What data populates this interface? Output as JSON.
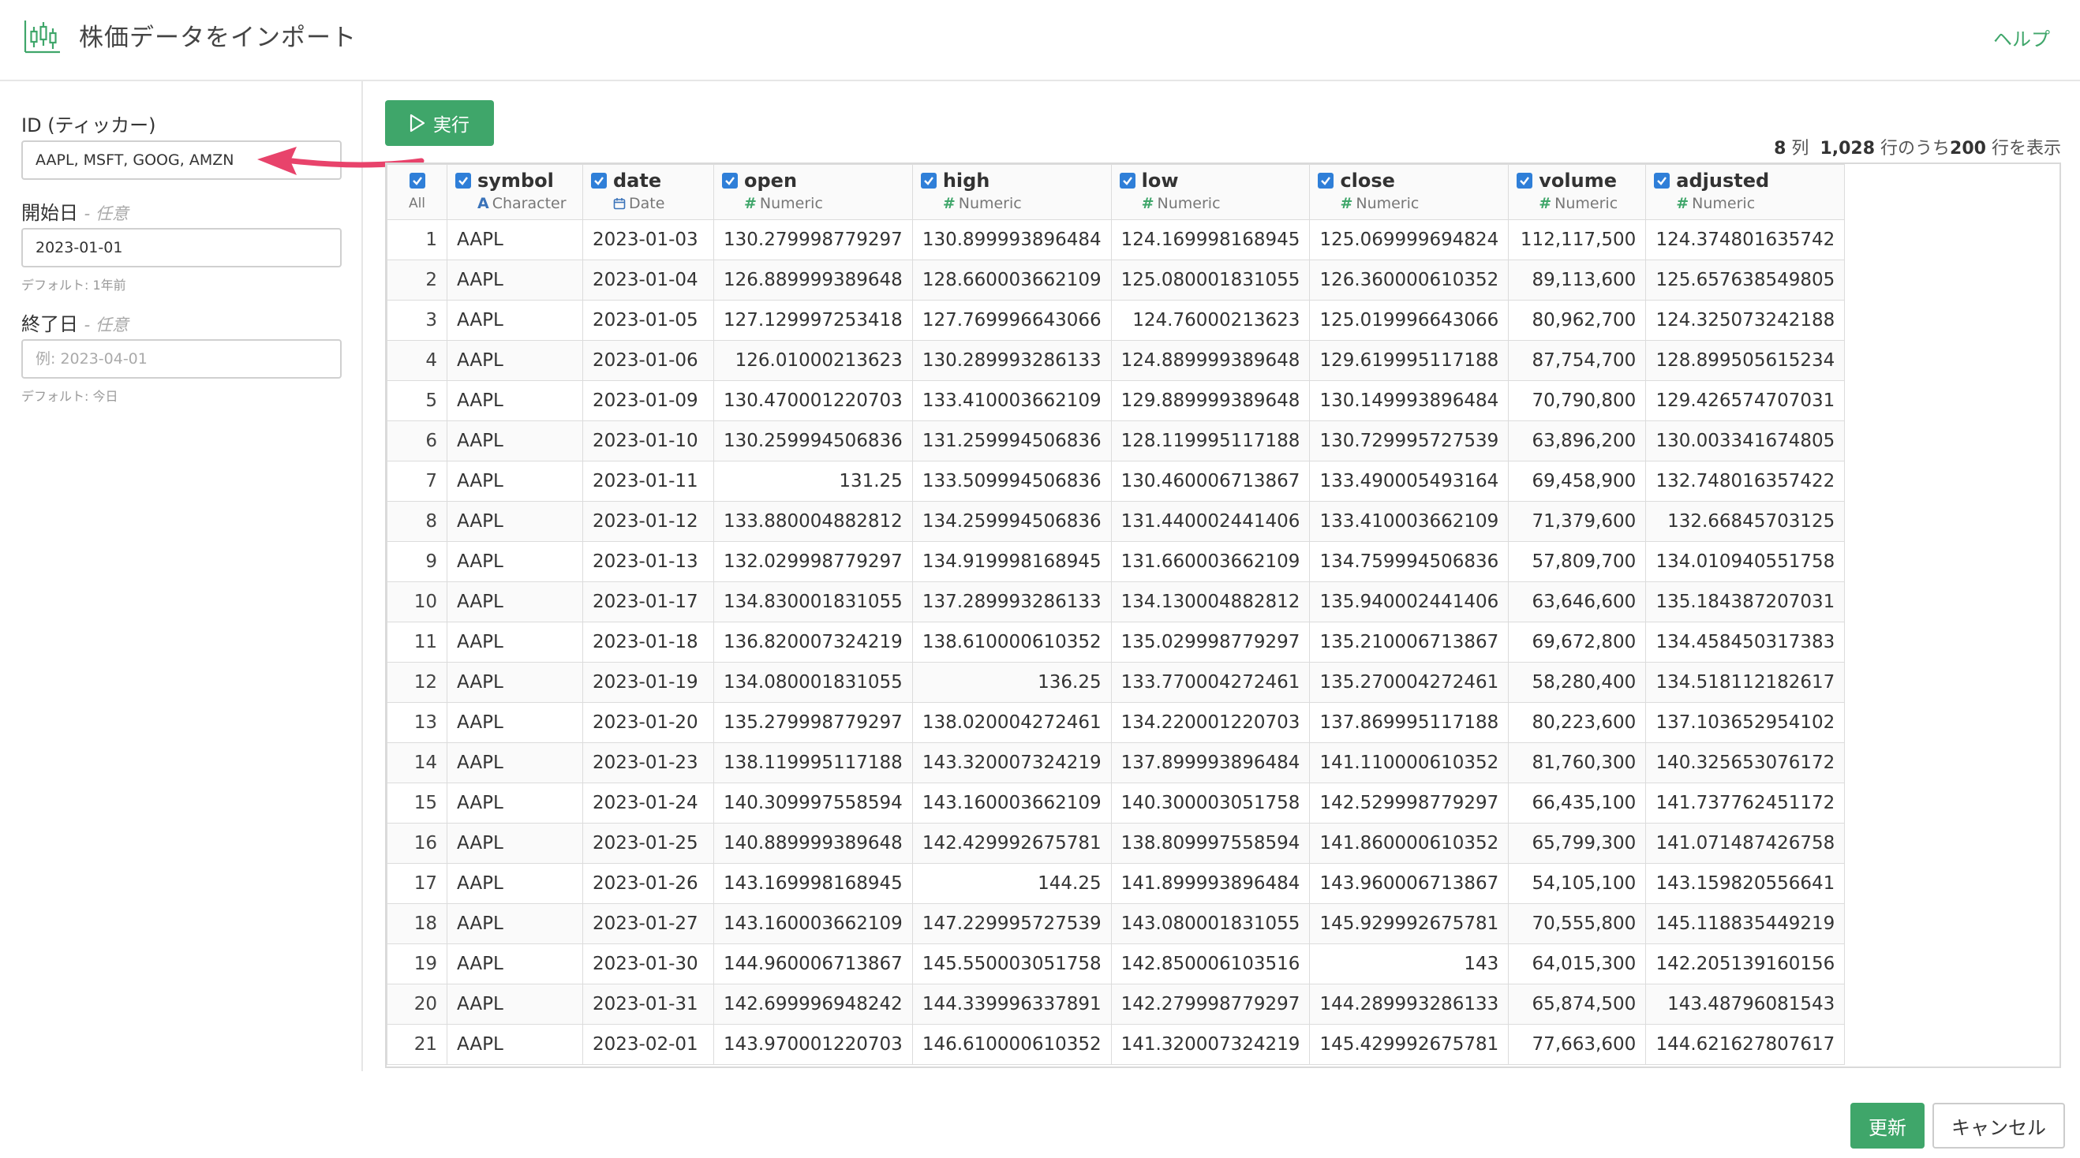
{
  "header": {
    "title": "株価データをインポート",
    "help_label": "ヘルプ"
  },
  "sidebar": {
    "id_label": "ID (ティッカー)",
    "id_value": "AAPL, MSFT, GOOG, AMZN",
    "start_label": "開始日",
    "start_optional": "- 任意",
    "start_value": "2023-01-01",
    "start_hint": "デフォルト: 1年前",
    "end_label": "終了日",
    "end_optional": "- 任意",
    "end_placeholder": "例: 2023-04-01",
    "end_hint": "デフォルト: 今日"
  },
  "toolbar": {
    "run_label": "実行"
  },
  "summary": {
    "cols": "8",
    "cols_unit": "列",
    "total_rows": "1,028",
    "middle_text": "行のうち",
    "shown_rows": "200",
    "tail_text": "行を表示"
  },
  "table": {
    "all_label": "All",
    "columns": [
      {
        "name": "symbol",
        "type": "Character",
        "type_icon": "A",
        "kind": "char"
      },
      {
        "name": "date",
        "type": "Date",
        "type_icon": "calendar-icon",
        "kind": "date"
      },
      {
        "name": "open",
        "type": "Numeric",
        "type_icon": "#",
        "kind": "num"
      },
      {
        "name": "high",
        "type": "Numeric",
        "type_icon": "#",
        "kind": "num"
      },
      {
        "name": "low",
        "type": "Numeric",
        "type_icon": "#",
        "kind": "num"
      },
      {
        "name": "close",
        "type": "Numeric",
        "type_icon": "#",
        "kind": "num"
      },
      {
        "name": "volume",
        "type": "Numeric",
        "type_icon": "#",
        "kind": "num"
      },
      {
        "name": "adjusted",
        "type": "Numeric",
        "type_icon": "#",
        "kind": "num"
      }
    ],
    "rows": [
      [
        "1",
        "AAPL",
        "2023-01-03",
        "130.279998779297",
        "130.899993896484",
        "124.169998168945",
        "125.069999694824",
        "112,117,500",
        "124.374801635742"
      ],
      [
        "2",
        "AAPL",
        "2023-01-04",
        "126.889999389648",
        "128.660003662109",
        "125.080001831055",
        "126.360000610352",
        "89,113,600",
        "125.657638549805"
      ],
      [
        "3",
        "AAPL",
        "2023-01-05",
        "127.129997253418",
        "127.769996643066",
        "124.76000213623",
        "125.019996643066",
        "80,962,700",
        "124.325073242188"
      ],
      [
        "4",
        "AAPL",
        "2023-01-06",
        "126.01000213623",
        "130.289993286133",
        "124.889999389648",
        "129.619995117188",
        "87,754,700",
        "128.899505615234"
      ],
      [
        "5",
        "AAPL",
        "2023-01-09",
        "130.470001220703",
        "133.410003662109",
        "129.889999389648",
        "130.149993896484",
        "70,790,800",
        "129.426574707031"
      ],
      [
        "6",
        "AAPL",
        "2023-01-10",
        "130.259994506836",
        "131.259994506836",
        "128.119995117188",
        "130.729995727539",
        "63,896,200",
        "130.003341674805"
      ],
      [
        "7",
        "AAPL",
        "2023-01-11",
        "131.25",
        "133.509994506836",
        "130.460006713867",
        "133.490005493164",
        "69,458,900",
        "132.748016357422"
      ],
      [
        "8",
        "AAPL",
        "2023-01-12",
        "133.880004882812",
        "134.259994506836",
        "131.440002441406",
        "133.410003662109",
        "71,379,600",
        "132.66845703125"
      ],
      [
        "9",
        "AAPL",
        "2023-01-13",
        "132.029998779297",
        "134.919998168945",
        "131.660003662109",
        "134.759994506836",
        "57,809,700",
        "134.010940551758"
      ],
      [
        "10",
        "AAPL",
        "2023-01-17",
        "134.830001831055",
        "137.289993286133",
        "134.130004882812",
        "135.940002441406",
        "63,646,600",
        "135.184387207031"
      ],
      [
        "11",
        "AAPL",
        "2023-01-18",
        "136.820007324219",
        "138.610000610352",
        "135.029998779297",
        "135.210006713867",
        "69,672,800",
        "134.458450317383"
      ],
      [
        "12",
        "AAPL",
        "2023-01-19",
        "134.080001831055",
        "136.25",
        "133.770004272461",
        "135.270004272461",
        "58,280,400",
        "134.518112182617"
      ],
      [
        "13",
        "AAPL",
        "2023-01-20",
        "135.279998779297",
        "138.020004272461",
        "134.220001220703",
        "137.869995117188",
        "80,223,600",
        "137.103652954102"
      ],
      [
        "14",
        "AAPL",
        "2023-01-23",
        "138.119995117188",
        "143.320007324219",
        "137.899993896484",
        "141.110000610352",
        "81,760,300",
        "140.325653076172"
      ],
      [
        "15",
        "AAPL",
        "2023-01-24",
        "140.309997558594",
        "143.160003662109",
        "140.300003051758",
        "142.529998779297",
        "66,435,100",
        "141.737762451172"
      ],
      [
        "16",
        "AAPL",
        "2023-01-25",
        "140.889999389648",
        "142.429992675781",
        "138.809997558594",
        "141.860000610352",
        "65,799,300",
        "141.071487426758"
      ],
      [
        "17",
        "AAPL",
        "2023-01-26",
        "143.169998168945",
        "144.25",
        "141.899993896484",
        "143.960006713867",
        "54,105,100",
        "143.159820556641"
      ],
      [
        "18",
        "AAPL",
        "2023-01-27",
        "143.160003662109",
        "147.229995727539",
        "143.080001831055",
        "145.929992675781",
        "70,555,800",
        "145.118835449219"
      ],
      [
        "19",
        "AAPL",
        "2023-01-30",
        "144.960006713867",
        "145.550003051758",
        "142.850006103516",
        "143",
        "64,015,300",
        "142.205139160156"
      ],
      [
        "20",
        "AAPL",
        "2023-01-31",
        "142.699996948242",
        "144.339996337891",
        "142.279998779297",
        "144.289993286133",
        "65,874,500",
        "143.48796081543"
      ],
      [
        "21",
        "AAPL",
        "2023-02-01",
        "143.970001220703",
        "146.610000610352",
        "141.320007324219",
        "145.429992675781",
        "77,663,600",
        "144.621627807617"
      ]
    ]
  },
  "footer": {
    "update_label": "更新",
    "cancel_label": "キャンセル"
  },
  "colors": {
    "accent_green": "#3fa66a",
    "checkbox_blue": "#2f7fd8",
    "arrow_pink": "#e8436b"
  }
}
